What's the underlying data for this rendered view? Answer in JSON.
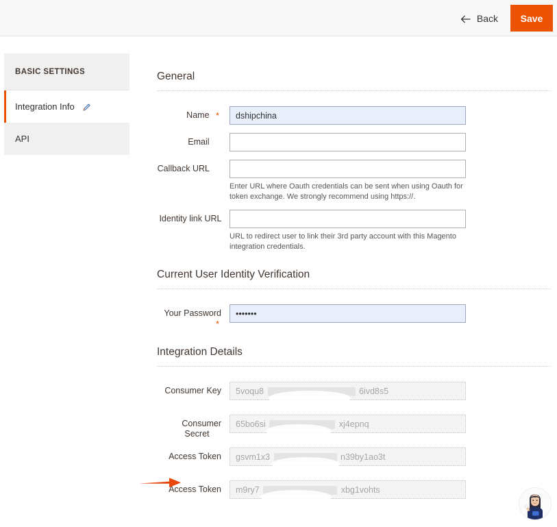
{
  "header": {
    "back_label": "Back",
    "back_icon": "arrow-left-icon",
    "save_label": "Save",
    "save_color": "#eb5202"
  },
  "sidebar": {
    "title": "BASIC SETTINGS",
    "items": [
      {
        "label": "Integration Info",
        "active": true,
        "icon": "pencil-icon"
      },
      {
        "label": "API",
        "active": false,
        "icon": ""
      }
    ]
  },
  "sections": {
    "general": {
      "title": "General",
      "fields": {
        "name": {
          "label": "Name",
          "required": true,
          "value": "dshipchina",
          "note": ""
        },
        "email": {
          "label": "Email",
          "required": false,
          "value": "",
          "note": ""
        },
        "callback_url": {
          "label": "Callback URL",
          "required": false,
          "value": "",
          "note": "Enter URL where Oauth credentials can be sent when using Oauth for token exchange. We strongly recommend using https://."
        },
        "identity_link_url": {
          "label": "Identity link URL",
          "required": false,
          "value": "",
          "note": "URL to redirect user to link their 3rd party account with this Magento integration credentials."
        }
      }
    },
    "identity_verification": {
      "title": "Current User Identity Verification",
      "fields": {
        "password": {
          "label": "Your Password",
          "required": true,
          "value": "•••••••",
          "note": ""
        }
      }
    },
    "integration_details": {
      "title": "Integration Details",
      "fields": {
        "consumer_key": {
          "label": "Consumer Key",
          "prefix": "5voqu8",
          "suffix": "6ivd8s5"
        },
        "consumer_secret": {
          "label": "Consumer Secret",
          "prefix": "65bo6si",
          "suffix": "xj4epnq"
        },
        "access_token": {
          "label": "Access Token",
          "prefix": "gsvm1x3",
          "suffix": "n39by1ao3t"
        },
        "access_token_secret": {
          "label": "Access Token",
          "prefix": "m9ry7",
          "suffix": "xbg1vohts"
        }
      }
    }
  },
  "annotation": {
    "arrow_color": "#e8470a",
    "points_to": "Access Token"
  },
  "chat_widget": {
    "icon": "support-agent-avatar"
  }
}
